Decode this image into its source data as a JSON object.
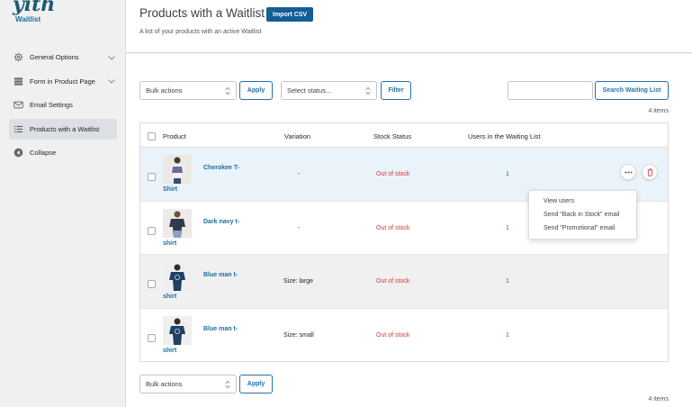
{
  "brand": {
    "logo": "yith",
    "name": "Waitlist"
  },
  "sidebar": {
    "items": [
      {
        "label": "General Options",
        "icon": "gear-icon",
        "chevron": true,
        "active": false
      },
      {
        "label": "Form in Product Page",
        "icon": "layers-icon",
        "chevron": true,
        "active": false
      },
      {
        "label": "Email Settings",
        "icon": "envelope-icon",
        "chevron": false,
        "active": false
      },
      {
        "label": "Products with a Waitlist",
        "icon": "list-icon",
        "chevron": false,
        "active": true
      },
      {
        "label": "Collapse",
        "icon": "collapse-arrow-icon",
        "chevron": false,
        "active": false
      }
    ]
  },
  "header": {
    "title": "Products with a Waitlist",
    "import_label": "Import CSV",
    "description": "A list of your products with an active Waitlist"
  },
  "toolbar": {
    "bulk_actions": "Bulk actions",
    "apply_label": "Apply",
    "status_placeholder": "Select status...",
    "filter_label": "Filter",
    "search_value": "",
    "search_label": "Search Waiting List",
    "items_count": "4 items"
  },
  "table": {
    "columns": [
      "Product",
      "Variation",
      "Stock Status",
      "Users in the Waiting List"
    ],
    "rows": [
      {
        "name_line1": "Cherokee T-",
        "name_line2": "Shirt",
        "variation": "-",
        "stock": "Out of stock",
        "users": "1"
      },
      {
        "name_line1": "Dark navy t-",
        "name_line2": "shirt",
        "variation": "-",
        "stock": "Out of stock",
        "users": "1"
      },
      {
        "name_line1": "Blue man t-",
        "name_line2": "shirt",
        "variation": "Size: large",
        "stock": "Out of stock",
        "users": "1"
      },
      {
        "name_line1": "Blue man t-",
        "name_line2": "shirt",
        "variation": "Size: small",
        "stock": "Out of stock",
        "users": "1"
      }
    ]
  },
  "row_actions": {
    "more_icon": "ellipsis-icon",
    "delete_icon": "trash-icon",
    "menu": [
      "View users",
      "Send \"Back in Stock\" email",
      "Send \"Promotional\" email"
    ]
  },
  "footer": {
    "bulk_actions": "Bulk actions",
    "apply_label": "Apply",
    "items_count": "4 items"
  },
  "colors": {
    "accent": "#2271b1",
    "link": "#1b6f9a",
    "out_of_stock": "#d63638",
    "highlight_row": "#eaf2fa"
  }
}
